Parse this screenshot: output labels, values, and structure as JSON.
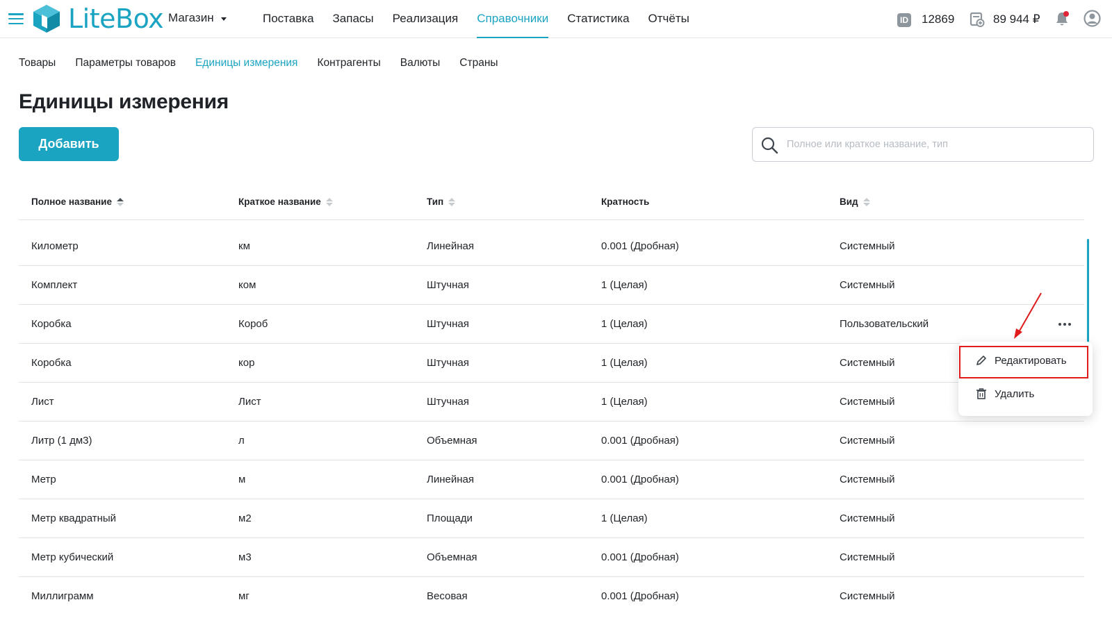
{
  "app": {
    "logo_text": "LiteBox",
    "store": "Магазин"
  },
  "main_nav": [
    {
      "label": "Поставка"
    },
    {
      "label": "Запасы"
    },
    {
      "label": "Реализация"
    },
    {
      "label": "Справочники",
      "active": true
    },
    {
      "label": "Статистика"
    },
    {
      "label": "Отчёты"
    }
  ],
  "account": {
    "id_badge": "ID",
    "id_value": "12869",
    "balance": "89 944 ₽"
  },
  "sub_nav": [
    {
      "label": "Товары"
    },
    {
      "label": "Параметры товаров"
    },
    {
      "label": "Единицы измерения",
      "active": true
    },
    {
      "label": "Контрагенты"
    },
    {
      "label": "Валюты"
    },
    {
      "label": "Страны"
    }
  ],
  "page": {
    "title": "Единицы измерения",
    "add_label": "Добавить"
  },
  "search": {
    "placeholder": "Полное или краткое название, тип",
    "value": ""
  },
  "table": {
    "headers": [
      "Полное название",
      "Краткое название",
      "Тип",
      "Кратность",
      "Вид"
    ],
    "rows": [
      [
        "Километр",
        "км",
        "Линейная",
        "0.001 (Дробная)",
        "Системный"
      ],
      [
        "Комплект",
        "ком",
        "Штучная",
        "1 (Целая)",
        "Системный"
      ],
      [
        "Коробка",
        "Короб",
        "Штучная",
        "1 (Целая)",
        "Пользовательский"
      ],
      [
        "Коробка",
        "кор",
        "Штучная",
        "1 (Целая)",
        "Системный"
      ],
      [
        "Лист",
        "Лист",
        "Штучная",
        "1 (Целая)",
        "Системный"
      ],
      [
        "Литр (1 дм3)",
        "л",
        "Объемная",
        "0.001 (Дробная)",
        "Системный"
      ],
      [
        "Метр",
        "м",
        "Линейная",
        "0.001 (Дробная)",
        "Системный"
      ],
      [
        "Метр квадратный",
        "м2",
        "Площади",
        "1 (Целая)",
        "Системный"
      ],
      [
        "Метр кубический",
        "м3",
        "Объемная",
        "0.001 (Дробная)",
        "Системный"
      ],
      [
        "Миллиграмм",
        "мг",
        "Весовая",
        "0.001 (Дробная)",
        "Системный"
      ]
    ]
  },
  "context_menu": {
    "edit_label": "Редактировать",
    "delete_label": "Удалить"
  },
  "colors": {
    "accent": "#1aa4c2",
    "highlight": "#e01b1b",
    "notification_dot": "#e0243a"
  }
}
